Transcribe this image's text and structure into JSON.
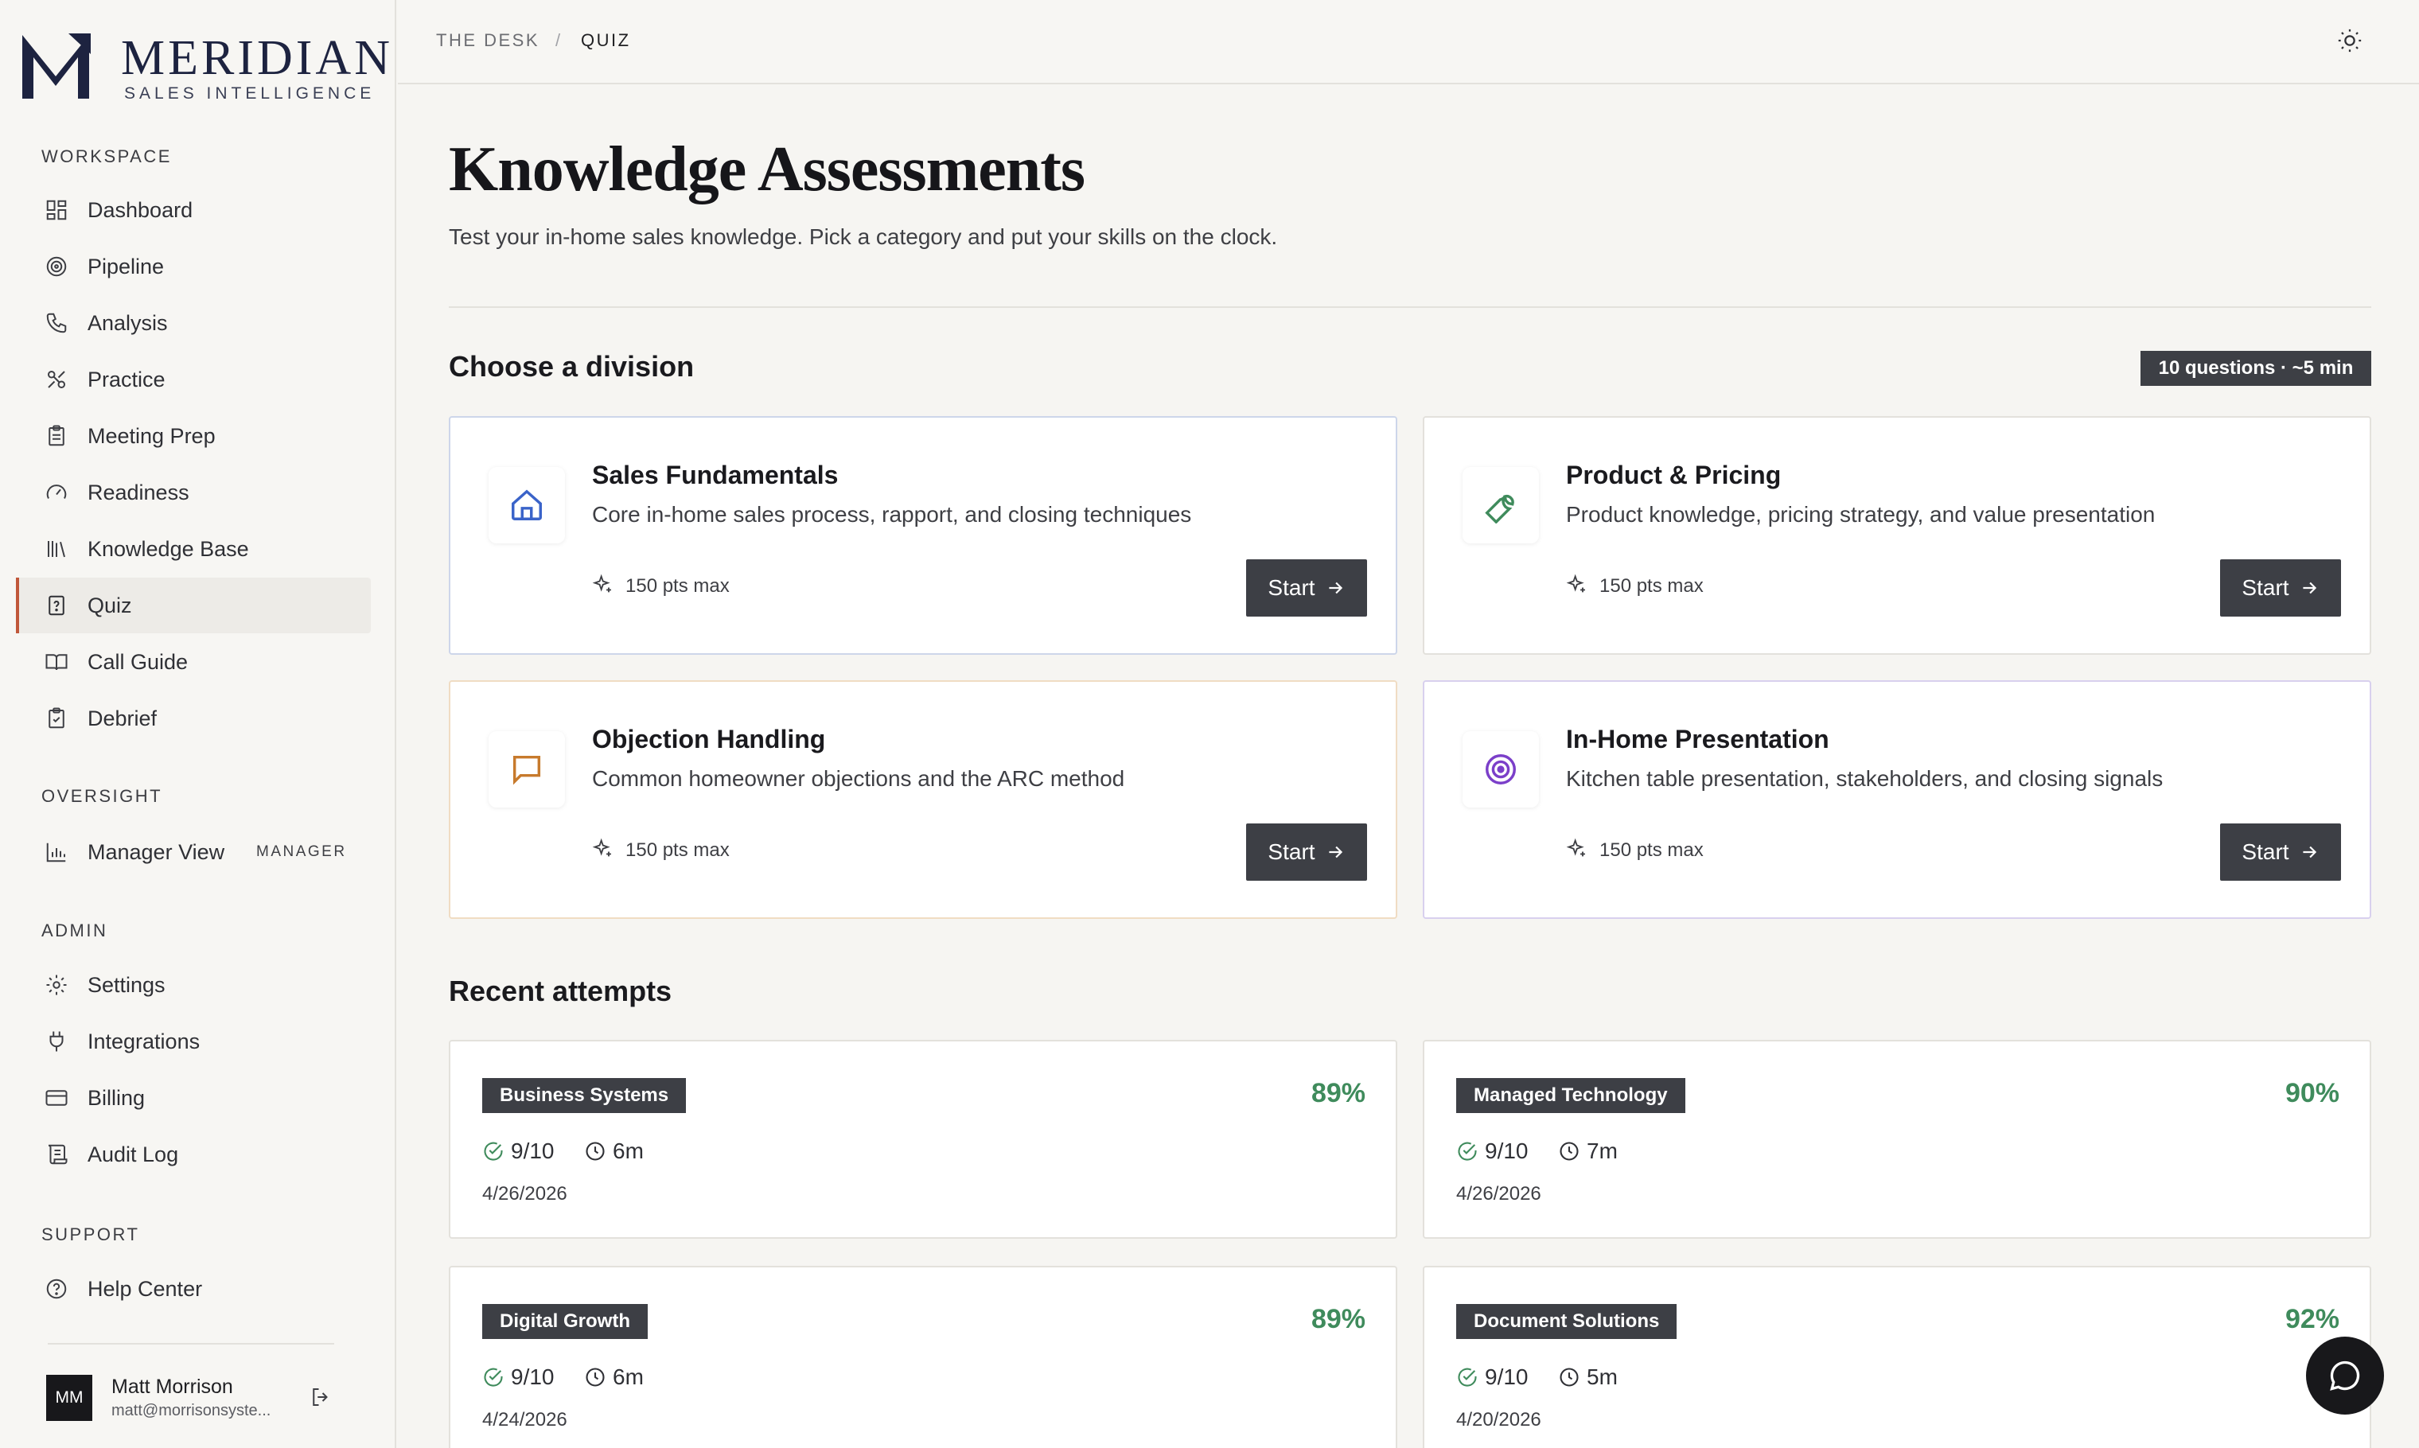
{
  "brand": {
    "name": "MERIDIAN",
    "tagline": "SALES INTELLIGENCE"
  },
  "sidebar": {
    "sections": [
      {
        "title": "WORKSPACE"
      },
      {
        "title": "OVERSIGHT"
      },
      {
        "title": "ADMIN"
      },
      {
        "title": "SUPPORT"
      }
    ],
    "items": [
      {
        "label": "Dashboard",
        "icon": "dashboard-icon"
      },
      {
        "label": "Pipeline",
        "icon": "target-icon"
      },
      {
        "label": "Analysis",
        "icon": "phone-icon"
      },
      {
        "label": "Practice",
        "icon": "practice-icon"
      },
      {
        "label": "Meeting Prep",
        "icon": "clipboard-icon"
      },
      {
        "label": "Readiness",
        "icon": "gauge-icon"
      },
      {
        "label": "Knowledge Base",
        "icon": "library-icon"
      },
      {
        "label": "Quiz",
        "icon": "quiz-icon",
        "active": true
      },
      {
        "label": "Call Guide",
        "icon": "book-icon"
      },
      {
        "label": "Debrief",
        "icon": "clipboard-check-icon"
      },
      {
        "label": "Manager View",
        "icon": "bar-chart-icon",
        "badge": "MANAGER"
      },
      {
        "label": "Settings",
        "icon": "gear-icon"
      },
      {
        "label": "Integrations",
        "icon": "plug-icon"
      },
      {
        "label": "Billing",
        "icon": "credit-card-icon"
      },
      {
        "label": "Audit Log",
        "icon": "scroll-icon"
      },
      {
        "label": "Help Center",
        "icon": "help-icon"
      }
    ],
    "user": {
      "initials": "MM",
      "name": "Matt Morrison",
      "email": "matt@morrisonsyste..."
    }
  },
  "breadcrumb": {
    "parent": "THE DESK",
    "separator": "/",
    "current": "QUIZ"
  },
  "page": {
    "title": "Knowledge Assessments",
    "subtitle": "Test your in-home sales knowledge. Pick a category and put your skills on the clock."
  },
  "divisions": {
    "heading": "Choose a division",
    "meta": "10 questions · ~5 min",
    "start_label": "Start",
    "cards": [
      {
        "title": "Sales Fundamentals",
        "description": "Core in-home sales process, rapport, and closing techniques",
        "points": "150 pts max",
        "icon": "home-icon",
        "color": "#3a63c9"
      },
      {
        "title": "Product & Pricing",
        "description": "Product knowledge, pricing strategy, and value presentation",
        "points": "150 pts max",
        "icon": "wrench-icon",
        "color": "#3f8b5c"
      },
      {
        "title": "Objection Handling",
        "description": "Common homeowner objections and the ARC method",
        "points": "150 pts max",
        "icon": "message-icon",
        "color": "#c77a2c"
      },
      {
        "title": "In-Home Presentation",
        "description": "Kitchen table presentation, stakeholders, and closing signals",
        "points": "150 pts max",
        "icon": "target-icon",
        "color": "#7b3fc9"
      }
    ]
  },
  "recent": {
    "heading": "Recent attempts",
    "attempts": [
      {
        "category": "Business Systems",
        "percent": "89%",
        "score": "9/10",
        "time": "6m",
        "date": "4/26/2026"
      },
      {
        "category": "Managed Technology",
        "percent": "90%",
        "score": "9/10",
        "time": "7m",
        "date": "4/26/2026"
      },
      {
        "category": "Digital Growth",
        "percent": "89%",
        "score": "9/10",
        "time": "6m",
        "date": "4/24/2026"
      },
      {
        "category": "Document Solutions",
        "percent": "92%",
        "score": "9/10",
        "time": "5m",
        "date": "4/20/2026"
      }
    ]
  },
  "colors": {
    "accent": "#c0573a",
    "dark": "#3d3f45",
    "success": "#3f8b5c"
  }
}
